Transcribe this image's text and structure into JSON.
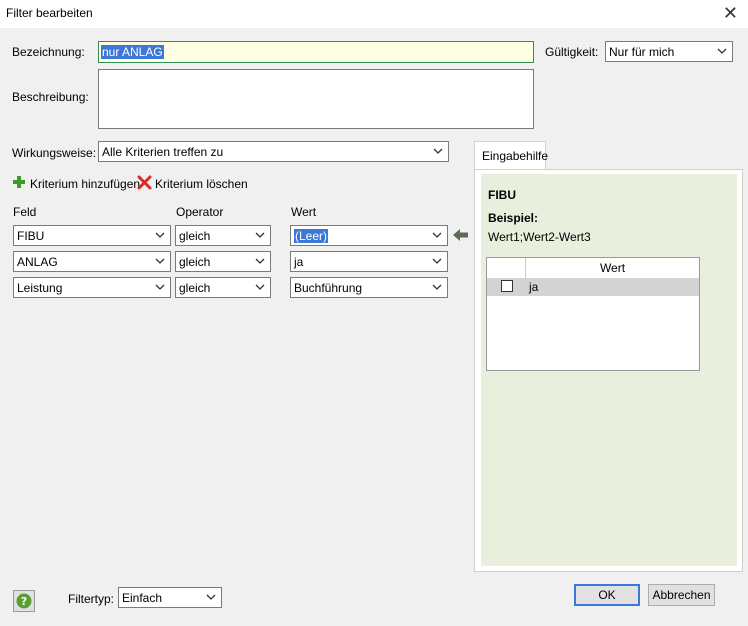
{
  "window": {
    "title": "Filter bearbeiten"
  },
  "form": {
    "bezeichnung_label": "Bezeichnung:",
    "bezeichnung_value": "nur ANLAG",
    "beschreibung_label": "Beschreibung:",
    "beschreibung_value": "",
    "gueltigkeit_label": "Gültigkeit:",
    "gueltigkeit_value": "Nur für mich",
    "wirkungsweise_label": "Wirkungsweise:",
    "wirkungsweise_value": "Alle Kriterien treffen zu"
  },
  "actions": {
    "add_label": "Kriterium hinzufügen",
    "delete_label": "Kriterium löschen"
  },
  "columns": {
    "feld": "Feld",
    "operator": "Operator",
    "wert": "Wert"
  },
  "criteria": [
    {
      "feld": "FIBU",
      "operator": "gleich",
      "wert": "(Leer)"
    },
    {
      "feld": "ANLAG",
      "operator": "gleich",
      "wert": "ja"
    },
    {
      "feld": "Leistung",
      "operator": "gleich",
      "wert": "Buchführung"
    }
  ],
  "help": {
    "tab_label": "Eingabehilfe",
    "field_name": "FIBU",
    "example_label": "Beispiel:",
    "example_value": "Wert1;Wert2-Wert3",
    "grid_header": "Wert",
    "grid_rows": [
      {
        "value": "ja",
        "checked": false
      }
    ]
  },
  "footer": {
    "filtertyp_label": "Filtertyp:",
    "filtertyp_value": "Einfach",
    "ok_label": "OK",
    "cancel_label": "Abbrechen"
  },
  "colors": {
    "accent": "#3c78d8",
    "panel_bg": "#e9efdd",
    "help_icon": "#5a9e2f",
    "delete_icon": "#d62b2b",
    "add_icon": "#3c9a2b"
  }
}
